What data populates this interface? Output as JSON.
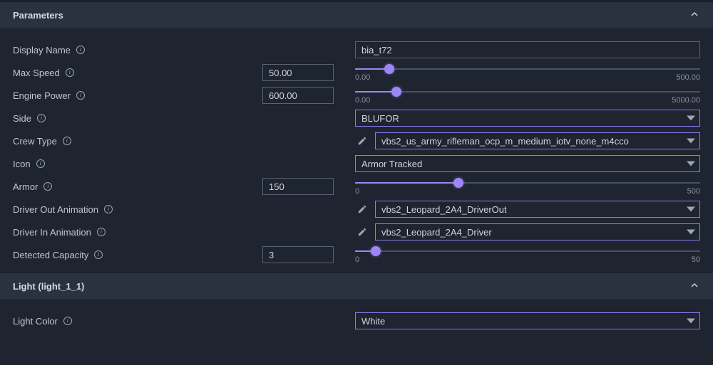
{
  "sections": {
    "parameters": {
      "title": "Parameters"
    },
    "light": {
      "title": "Light (light_1_1)"
    }
  },
  "params": {
    "display_name": {
      "label": "Display Name",
      "value": "bia_t72"
    },
    "max_speed": {
      "label": "Max Speed",
      "value": "50.00",
      "min": "0.00",
      "max": "500.00",
      "pct": 10
    },
    "engine_power": {
      "label": "Engine Power",
      "value": "600.00",
      "min": "0.00",
      "max": "5000.00",
      "pct": 12
    },
    "side": {
      "label": "Side",
      "value": "BLUFOR"
    },
    "crew_type": {
      "label": "Crew Type",
      "value": "vbs2_us_army_rifleman_ocp_m_medium_iotv_none_m4cco"
    },
    "icon": {
      "label": "Icon",
      "value": "Armor Tracked"
    },
    "armor": {
      "label": "Armor",
      "value": "150",
      "min": "0",
      "max": "500",
      "pct": 30
    },
    "driver_out": {
      "label": "Driver Out Animation",
      "value": "vbs2_Leopard_2A4_DriverOut"
    },
    "driver_in": {
      "label": "Driver In Animation",
      "value": "vbs2_Leopard_2A4_Driver"
    },
    "detected_capacity": {
      "label": "Detected Capacity",
      "value": "3",
      "min": "0",
      "max": "50",
      "pct": 6
    }
  },
  "light": {
    "color": {
      "label": "Light Color",
      "value": "White"
    }
  }
}
